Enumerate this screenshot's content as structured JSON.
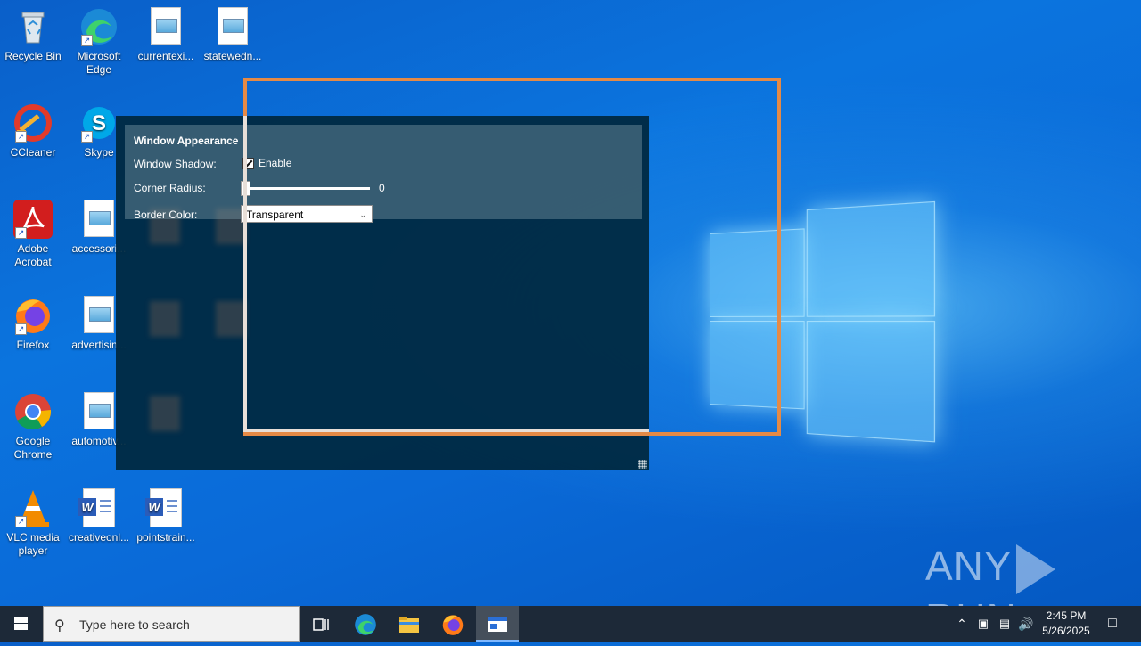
{
  "desktop": {
    "icons": [
      {
        "label": "Recycle Bin",
        "name": "recycle-bin-icon"
      },
      {
        "label": "Microsoft Edge",
        "name": "edge-icon"
      },
      {
        "label": "currentexi...",
        "name": "image-file-icon"
      },
      {
        "label": "statewedn...",
        "name": "image-file-icon"
      },
      {
        "label": "CCleaner",
        "name": "ccleaner-icon"
      },
      {
        "label": "Skype",
        "name": "skype-icon"
      },
      {
        "label": "Adobe Acrobat",
        "name": "adobe-acrobat-icon"
      },
      {
        "label": "accessori...",
        "name": "image-file-icon"
      },
      {
        "label": "Firefox",
        "name": "firefox-icon"
      },
      {
        "label": "advertisin...",
        "name": "image-file-icon"
      },
      {
        "label": "Google Chrome",
        "name": "chrome-icon"
      },
      {
        "label": "automotiv...",
        "name": "image-file-icon"
      },
      {
        "label": "VLC media player",
        "name": "vlc-icon"
      },
      {
        "label": "creativeonl...",
        "name": "word-document-icon"
      },
      {
        "label": "pointstrain...",
        "name": "word-document-icon"
      }
    ]
  },
  "app": {
    "section_title": "Window Appearance",
    "shadow_label": "Window Shadow:",
    "shadow_checkbox_label": "Enable",
    "shadow_enabled": true,
    "radius_label": "Corner Radius:",
    "radius_value": "0",
    "border_label": "Border Color:",
    "border_selected": "Transparent"
  },
  "taskbar": {
    "search_placeholder": "Type here to search",
    "time": "2:45 PM",
    "date": "5/26/2025"
  },
  "watermark": {
    "left": "ANY",
    "right": "RUN"
  },
  "colors": {
    "selection_border": "#e58a46",
    "taskbar": "#1d2938",
    "app_bg": "#00283e"
  }
}
